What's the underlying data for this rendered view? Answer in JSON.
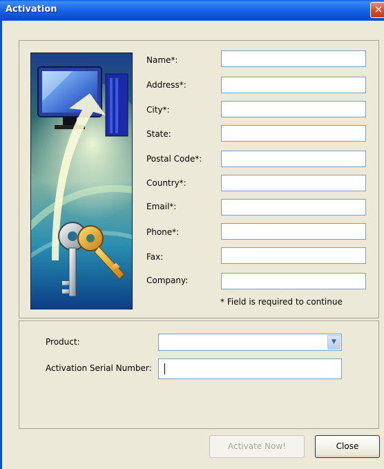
{
  "window": {
    "title": "Activation",
    "close_glyph": "✕"
  },
  "form": {
    "fields": [
      {
        "label": "Name*:",
        "value": ""
      },
      {
        "label": "Address*:",
        "value": ""
      },
      {
        "label": "City*:",
        "value": ""
      },
      {
        "label": "State:",
        "value": ""
      },
      {
        "label": "Postal Code*:",
        "value": ""
      },
      {
        "label": "Country*:",
        "value": ""
      },
      {
        "label": "Email*:",
        "value": ""
      },
      {
        "label": "Phone*:",
        "value": ""
      },
      {
        "label": "Fax:",
        "value": ""
      },
      {
        "label": "Company:",
        "value": ""
      }
    ],
    "required_note": "* Field is required to continue"
  },
  "product": {
    "label": "Product:",
    "selected": "",
    "dropdown_glyph": "▼"
  },
  "serial": {
    "label": "Activation Serial Number:",
    "value": ""
  },
  "buttons": {
    "activate_label": "Activate Now!",
    "activate_enabled": false,
    "close_label": "Close"
  },
  "icons": {
    "illustration": "computer-keys-illustration"
  },
  "colors": {
    "titlebar": "#0b52d8",
    "face": "#ece9d8",
    "input_border": "#7f9db9"
  }
}
